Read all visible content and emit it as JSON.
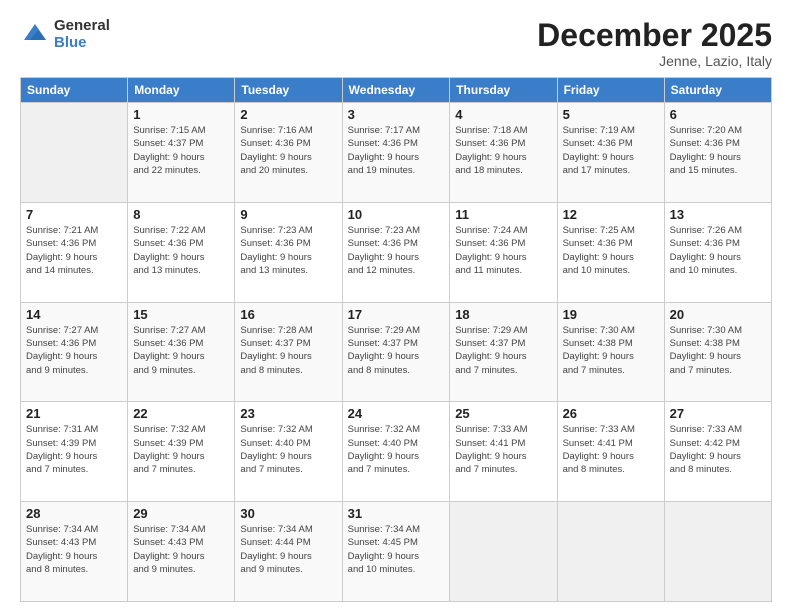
{
  "logo": {
    "general": "General",
    "blue": "Blue"
  },
  "header": {
    "month": "December 2025",
    "location": "Jenne, Lazio, Italy"
  },
  "days_of_week": [
    "Sunday",
    "Monday",
    "Tuesday",
    "Wednesday",
    "Thursday",
    "Friday",
    "Saturday"
  ],
  "weeks": [
    [
      {
        "day": "",
        "info": ""
      },
      {
        "day": "1",
        "info": "Sunrise: 7:15 AM\nSunset: 4:37 PM\nDaylight: 9 hours\nand 22 minutes."
      },
      {
        "day": "2",
        "info": "Sunrise: 7:16 AM\nSunset: 4:36 PM\nDaylight: 9 hours\nand 20 minutes."
      },
      {
        "day": "3",
        "info": "Sunrise: 7:17 AM\nSunset: 4:36 PM\nDaylight: 9 hours\nand 19 minutes."
      },
      {
        "day": "4",
        "info": "Sunrise: 7:18 AM\nSunset: 4:36 PM\nDaylight: 9 hours\nand 18 minutes."
      },
      {
        "day": "5",
        "info": "Sunrise: 7:19 AM\nSunset: 4:36 PM\nDaylight: 9 hours\nand 17 minutes."
      },
      {
        "day": "6",
        "info": "Sunrise: 7:20 AM\nSunset: 4:36 PM\nDaylight: 9 hours\nand 15 minutes."
      }
    ],
    [
      {
        "day": "7",
        "info": "Sunrise: 7:21 AM\nSunset: 4:36 PM\nDaylight: 9 hours\nand 14 minutes."
      },
      {
        "day": "8",
        "info": "Sunrise: 7:22 AM\nSunset: 4:36 PM\nDaylight: 9 hours\nand 13 minutes."
      },
      {
        "day": "9",
        "info": "Sunrise: 7:23 AM\nSunset: 4:36 PM\nDaylight: 9 hours\nand 13 minutes."
      },
      {
        "day": "10",
        "info": "Sunrise: 7:23 AM\nSunset: 4:36 PM\nDaylight: 9 hours\nand 12 minutes."
      },
      {
        "day": "11",
        "info": "Sunrise: 7:24 AM\nSunset: 4:36 PM\nDaylight: 9 hours\nand 11 minutes."
      },
      {
        "day": "12",
        "info": "Sunrise: 7:25 AM\nSunset: 4:36 PM\nDaylight: 9 hours\nand 10 minutes."
      },
      {
        "day": "13",
        "info": "Sunrise: 7:26 AM\nSunset: 4:36 PM\nDaylight: 9 hours\nand 10 minutes."
      }
    ],
    [
      {
        "day": "14",
        "info": "Sunrise: 7:27 AM\nSunset: 4:36 PM\nDaylight: 9 hours\nand 9 minutes."
      },
      {
        "day": "15",
        "info": "Sunrise: 7:27 AM\nSunset: 4:36 PM\nDaylight: 9 hours\nand 9 minutes."
      },
      {
        "day": "16",
        "info": "Sunrise: 7:28 AM\nSunset: 4:37 PM\nDaylight: 9 hours\nand 8 minutes."
      },
      {
        "day": "17",
        "info": "Sunrise: 7:29 AM\nSunset: 4:37 PM\nDaylight: 9 hours\nand 8 minutes."
      },
      {
        "day": "18",
        "info": "Sunrise: 7:29 AM\nSunset: 4:37 PM\nDaylight: 9 hours\nand 7 minutes."
      },
      {
        "day": "19",
        "info": "Sunrise: 7:30 AM\nSunset: 4:38 PM\nDaylight: 9 hours\nand 7 minutes."
      },
      {
        "day": "20",
        "info": "Sunrise: 7:30 AM\nSunset: 4:38 PM\nDaylight: 9 hours\nand 7 minutes."
      }
    ],
    [
      {
        "day": "21",
        "info": "Sunrise: 7:31 AM\nSunset: 4:39 PM\nDaylight: 9 hours\nand 7 minutes."
      },
      {
        "day": "22",
        "info": "Sunrise: 7:32 AM\nSunset: 4:39 PM\nDaylight: 9 hours\nand 7 minutes."
      },
      {
        "day": "23",
        "info": "Sunrise: 7:32 AM\nSunset: 4:40 PM\nDaylight: 9 hours\nand 7 minutes."
      },
      {
        "day": "24",
        "info": "Sunrise: 7:32 AM\nSunset: 4:40 PM\nDaylight: 9 hours\nand 7 minutes."
      },
      {
        "day": "25",
        "info": "Sunrise: 7:33 AM\nSunset: 4:41 PM\nDaylight: 9 hours\nand 7 minutes."
      },
      {
        "day": "26",
        "info": "Sunrise: 7:33 AM\nSunset: 4:41 PM\nDaylight: 9 hours\nand 8 minutes."
      },
      {
        "day": "27",
        "info": "Sunrise: 7:33 AM\nSunset: 4:42 PM\nDaylight: 9 hours\nand 8 minutes."
      }
    ],
    [
      {
        "day": "28",
        "info": "Sunrise: 7:34 AM\nSunset: 4:43 PM\nDaylight: 9 hours\nand 8 minutes."
      },
      {
        "day": "29",
        "info": "Sunrise: 7:34 AM\nSunset: 4:43 PM\nDaylight: 9 hours\nand 9 minutes."
      },
      {
        "day": "30",
        "info": "Sunrise: 7:34 AM\nSunset: 4:44 PM\nDaylight: 9 hours\nand 9 minutes."
      },
      {
        "day": "31",
        "info": "Sunrise: 7:34 AM\nSunset: 4:45 PM\nDaylight: 9 hours\nand 10 minutes."
      },
      {
        "day": "",
        "info": ""
      },
      {
        "day": "",
        "info": ""
      },
      {
        "day": "",
        "info": ""
      }
    ]
  ]
}
